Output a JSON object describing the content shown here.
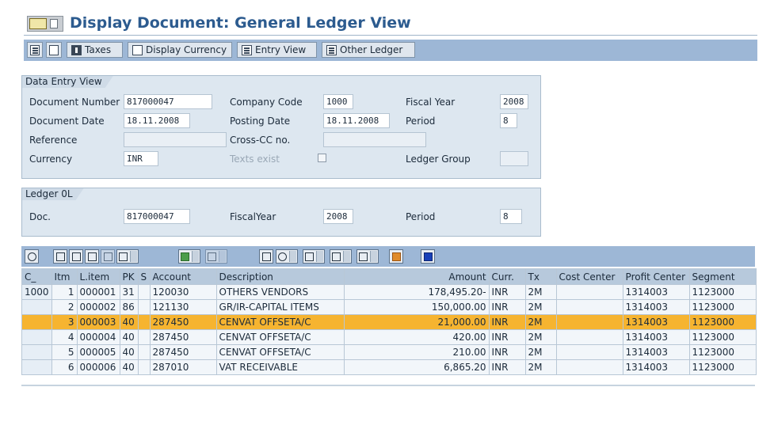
{
  "title": "Display Document: General Ledger View",
  "toolbar": {
    "buttons": [
      "Taxes",
      "Display Currency",
      "Entry View",
      "Other Ledger"
    ]
  },
  "data_entry_view": {
    "group_title": "Data Entry View",
    "document_number_label": "Document Number",
    "document_number": "817000047",
    "company_code_label": "Company Code",
    "company_code": "1000",
    "fiscal_year_label": "Fiscal Year",
    "fiscal_year": "2008",
    "document_date_label": "Document Date",
    "document_date": "18.11.2008",
    "posting_date_label": "Posting Date",
    "posting_date": "18.11.2008",
    "period_label": "Period",
    "period": "8",
    "reference_label": "Reference",
    "reference": "",
    "cross_cc_label": "Cross-CC no.",
    "cross_cc": "",
    "currency_label": "Currency",
    "currency": "INR",
    "texts_exist_label": "Texts exist",
    "ledger_group_label": "Ledger Group",
    "ledger_group": ""
  },
  "ledger_box": {
    "group_title": "Ledger 0L",
    "doc_label": "Doc.",
    "doc": "817000047",
    "fiscal_year_label": "FiscalYear",
    "fiscal_year": "2008",
    "period_label": "Period",
    "period": "8"
  },
  "table": {
    "headers": [
      "C_",
      "Itm",
      "L.item",
      "PK",
      "S",
      "Account",
      "Description",
      "Amount",
      "Curr.",
      "Tx",
      "Cost Center",
      "Profit Center",
      "Segment"
    ],
    "rows": [
      [
        "1000",
        "1",
        "000001",
        "31",
        "",
        "120030",
        "OTHERS VENDORS",
        "178,495.20-",
        "INR",
        "2M",
        "",
        "1314003",
        "1123000"
      ],
      [
        "",
        "2",
        "000002",
        "86",
        "",
        "121130",
        "GR/IR-CAPITAL ITEMS",
        "150,000.00",
        "INR",
        "2M",
        "",
        "1314003",
        "1123000"
      ],
      [
        "",
        "3",
        "000003",
        "40",
        "",
        "287450",
        "CENVAT OFFSETA/C",
        "21,000.00",
        "INR",
        "2M",
        "",
        "1314003",
        "1123000"
      ],
      [
        "",
        "4",
        "000004",
        "40",
        "",
        "287450",
        "CENVAT OFFSETA/C",
        "420.00",
        "INR",
        "2M",
        "",
        "1314003",
        "1123000"
      ],
      [
        "",
        "5",
        "000005",
        "40",
        "",
        "287450",
        "CENVAT OFFSETA/C",
        "210.00",
        "INR",
        "2M",
        "",
        "1314003",
        "1123000"
      ],
      [
        "",
        "6",
        "000006",
        "40",
        "",
        "287010",
        "VAT RECEIVABLE",
        "6,865.20",
        "INR",
        "2M",
        "",
        "1314003",
        "1123000"
      ]
    ],
    "selected_row": 3
  },
  "colors": {
    "title": "#2c5b8f",
    "toolbar_bg": "#9db7d6",
    "group_bg": "#dde7f0",
    "header_bg": "#b7c9dc",
    "selected_row": "#f6b430"
  }
}
